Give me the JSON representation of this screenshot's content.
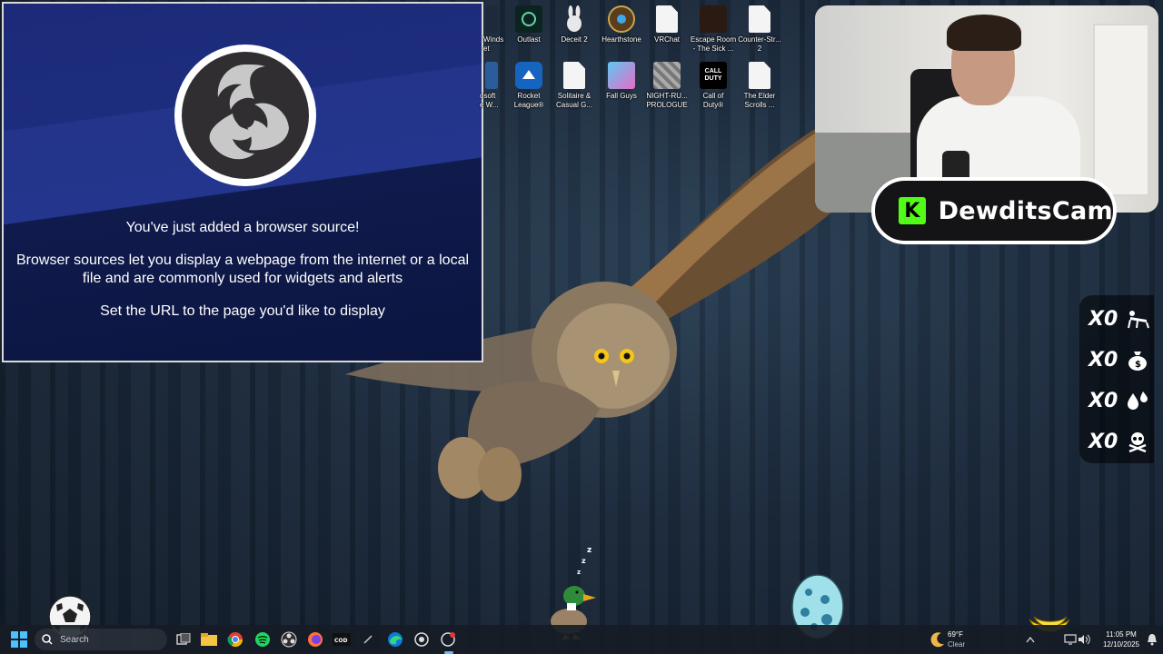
{
  "obs_panel": {
    "title": "You've just added a browser source!",
    "description": "Browser sources let you display a webpage from the internet or a local file and are commonly used for widgets and alerts",
    "instruction": "Set the URL to the page you'd like to display"
  },
  "desktop_icons": [
    {
      "label": "Winds\net",
      "icon": "game-icon"
    },
    {
      "label": "Outlast",
      "icon": "outlast-icon"
    },
    {
      "label": "Deceit 2",
      "icon": "rabbit-icon"
    },
    {
      "label": "Hearthstone",
      "icon": "hearthstone-icon"
    },
    {
      "label": "VRChat",
      "icon": "document-icon"
    },
    {
      "label": "Escape Room\n- The Sick ...",
      "icon": "game-icon"
    },
    {
      "label": "Counter-Str...\n2",
      "icon": "document-icon"
    },
    {
      "label": "osoft\ne W...",
      "icon": "app-icon"
    },
    {
      "label": "Rocket\nLeague®",
      "icon": "rocket-league-icon"
    },
    {
      "label": "Solitaire &\nCasual G...",
      "icon": "document-icon"
    },
    {
      "label": "Fall Guys",
      "icon": "fall-guys-icon"
    },
    {
      "label": "NIGHT-RU...\nPROLOGUE",
      "icon": "game-icon"
    },
    {
      "label": "Call of\nDuty®",
      "icon": "call-of-duty-icon"
    },
    {
      "label": "The Elder\nScrolls ...",
      "icon": "document-icon"
    }
  ],
  "webcam": {
    "channel_name": "DewditsCam",
    "platform_icon": "kick-icon",
    "accent_color": "#53fc18"
  },
  "counters": [
    {
      "value": "X0",
      "icon": "pushups-icon"
    },
    {
      "value": "X0",
      "icon": "money-bag-icon"
    },
    {
      "value": "X0",
      "icon": "water-drops-icon"
    },
    {
      "value": "X0",
      "icon": "skull-crossbones-icon"
    }
  ],
  "taskbar": {
    "search_placeholder": "Search",
    "pinned_apps": [
      "windows-start-icon",
      "task-view-icon",
      "file-explorer-icon",
      "chrome-icon",
      "spotify-icon",
      "obs-icon",
      "firefox-icon",
      "call-of-duty-icon",
      "app-icon",
      "edge-icon",
      "steam-icon",
      "recording-icon"
    ],
    "weather_temp": "69°F",
    "weather_desc": "Clear",
    "time": "11:05 PM",
    "date": "12/10/2025"
  },
  "overlays": {
    "sleep_text": "z z z"
  }
}
